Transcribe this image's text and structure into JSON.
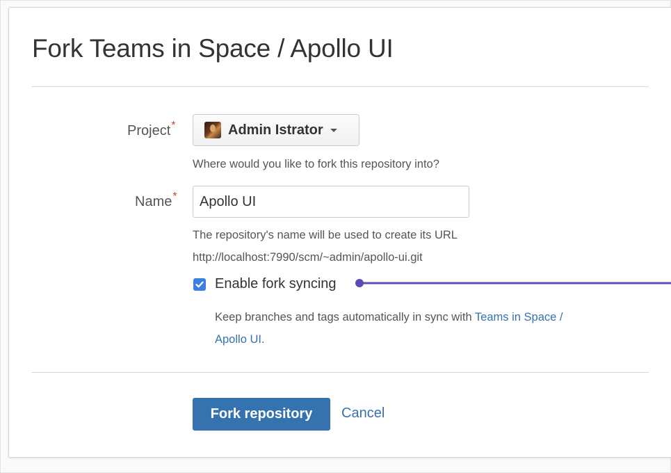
{
  "dialog": {
    "title": "Fork Teams in Space / Apollo UI"
  },
  "project": {
    "label": "Project",
    "required_marker": "*",
    "selected": "Admin Istrator",
    "help": "Where would you like to fork this repository into?"
  },
  "name": {
    "label": "Name",
    "required_marker": "*",
    "value": "Apollo UI",
    "help": "The repository's name will be used to create its URL",
    "url": "http://localhost:7990/scm/~admin/apollo-ui.git"
  },
  "sync": {
    "checked": true,
    "label": "Enable fork syncing",
    "help_prefix": "Keep branches and tags automatically in sync with ",
    "help_link_line1": "Teams in Space /",
    "help_link_line2": "Apollo UI",
    "help_suffix": "."
  },
  "actions": {
    "primary": "Fork repository",
    "cancel": "Cancel"
  },
  "colors": {
    "primary": "#3572b0",
    "link": "#3572b0",
    "required": "#d04437",
    "checkbox": "#3b7fe0",
    "callout": "#5b4bb7"
  },
  "icons": {
    "avatar": "user-avatar-icon",
    "caret": "chevron-down-icon",
    "check": "checkmark-icon"
  }
}
